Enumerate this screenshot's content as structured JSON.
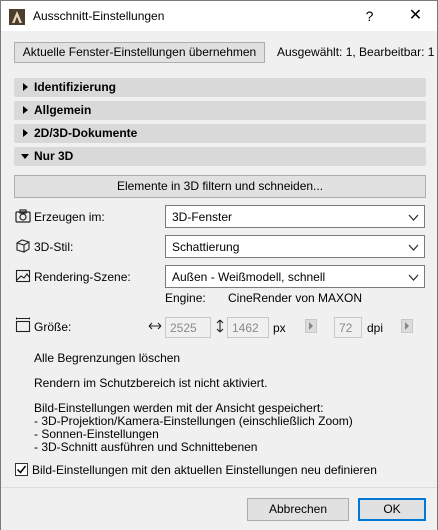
{
  "window": {
    "title": "Ausschnitt-Einstellungen",
    "help": "?",
    "close": "✕"
  },
  "top": {
    "apply_button": "Aktuelle Fenster-Einstellungen übernehmen",
    "selection_status": "Ausgewählt: 1, Bearbeitbar: 1"
  },
  "sections": [
    {
      "label": "Identifizierung",
      "expanded": false
    },
    {
      "label": "Allgemein",
      "expanded": false
    },
    {
      "label": "2D/3D-Dokumente",
      "expanded": false
    },
    {
      "label": "Nur 3D",
      "expanded": true
    }
  ],
  "only3d": {
    "filter_button": "Elemente in 3D filtern und schneiden...",
    "create_in_label": "Erzeugen im:",
    "create_in_value": "3D-Fenster",
    "style_label": "3D-Stil:",
    "style_value": "Schattierung",
    "scene_label": "Rendering-Szene:",
    "scene_value": "Außen - Weißmodell, schnell",
    "engine_label": "Engine:",
    "engine_value": "CineRender von MAXON",
    "size_label": "Größe:",
    "width_value": "2525",
    "height_value": "1462",
    "px_unit": "px",
    "dpi_value": "72",
    "dpi_unit": "dpi",
    "clear_limits": "Alle Begrenzungen löschen",
    "protected_area": "Rendern im Schutzbereich ist nicht aktiviert.",
    "info_lines": [
      "Bild-Einstellungen werden mit der Ansicht gespeichert:",
      "- 3D-Projektion/Kamera-Einstellungen (einschließlich Zoom)",
      "- Sonnen-Einstellungen",
      "- 3D-Schnitt ausführen und Schnittebenen"
    ],
    "redefine_checkbox_label": "Bild-Einstellungen mit den aktuellen Einstellungen neu definieren",
    "redefine_checked": true
  },
  "footer": {
    "cancel": "Abbrechen",
    "ok": "OK"
  },
  "icons": {
    "app": "archicad-icon",
    "camera": "camera-icon",
    "cube": "cube-icon",
    "scene": "scene-icon",
    "size": "size-icon"
  }
}
